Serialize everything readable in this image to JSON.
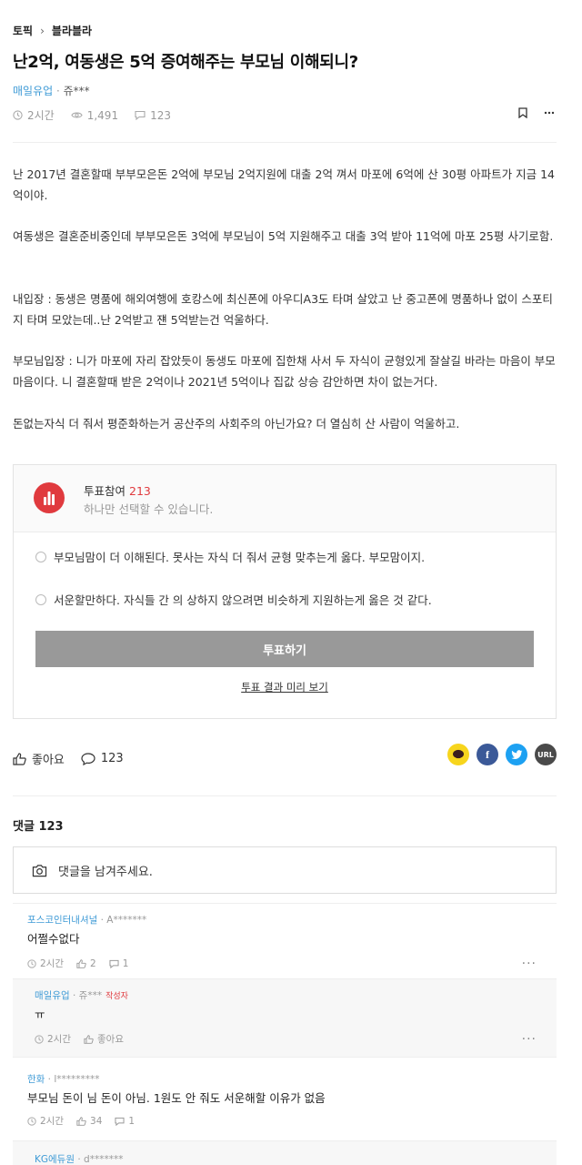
{
  "breadcrumb": {
    "topic": "토픽",
    "sep": "›",
    "board": "블라블라"
  },
  "post": {
    "title": "난2억, 여동생은 5억 증여해주는 부모님 이해되니?",
    "author_company": "매일유업",
    "author_sep": " · ",
    "author_nick": "쥬***",
    "time": "2시간",
    "views": "1,491",
    "comments": "123",
    "paragraphs": [
      "난 2017년 결혼할때 부부모은돈 2억에 부모님 2억지원에 대출 2억 껴서 마포에 6억에 산 30평 아파트가 지금 14억이야.",
      "여동생은 결혼준비중인데 부부모은돈 3억에 부모님이 5억 지원해주고 대출 3억 받아 11억에 마포 25평 사기로함.",
      "내입장 : 동생은 명품에 해외여행에 호캉스에 최신폰에 아우디A3도 타며 살았고 난 중고폰에 명품하나 없이 스포티지 타며 모았는데..난 2억받고 쟨 5억받는건 억울하다.",
      "부모님입장 : 니가 마포에 자리 잡았듯이 동생도 마포에 집한채 사서 두 자식이 균형있게 잘살길 바라는 마음이 부모마음이다. 니 결혼할때 받은 2억이나 2021년 5억이나 집값 상승 감안하면 차이 없는거다.",
      "돈없는자식 더 줘서 평준화하는거 공산주의 사회주의 아닌가요? 더 열심히 산 사람이 억울하고."
    ]
  },
  "poll": {
    "label": "투표참여",
    "count": "213",
    "sub": "하나만 선택할 수 있습니다.",
    "options": [
      "부모님맘이 더 이해된다. 못사는 자식 더 줘서 균형 맞추는게 옳다. 부모맘이지.",
      "서운할만하다. 자식들 간 의 상하지 않으려면 비슷하게 지원하는게 옳은 것 같다."
    ],
    "vote_label": "투표하기",
    "preview_label": "투표 결과 미리 보기"
  },
  "reactions": {
    "like_label": "좋아요",
    "comment_count": "123"
  },
  "share": {
    "url_label": "URL"
  },
  "comments_section": {
    "title": "댓글 123",
    "input_placeholder": "댓글을 남겨주세요."
  },
  "comments": [
    {
      "company": "포스코인터내셔널",
      "sep": " · ",
      "nick": "A*******",
      "op": "",
      "text": "어쩔수없다",
      "time": "2시간",
      "likes": "2",
      "replies": "1",
      "reply": false
    },
    {
      "company": "매일유업",
      "sep": " · ",
      "nick": "쥬***",
      "op": "작성자",
      "text": "ㅠ",
      "time": "2시간",
      "likes": "좋아요",
      "replies": "",
      "reply": true
    },
    {
      "company": "한화",
      "sep": " · ",
      "nick": "l*********",
      "op": "",
      "text": "부모님 돈이 님 돈이 아님. 1원도 안 줘도 서운해할 이유가 없음",
      "time": "2시간",
      "likes": "34",
      "replies": "1",
      "reply": false
    },
    {
      "company": "KG에듀원",
      "sep": " · ",
      "nick": "d*******",
      "op": "",
      "text": "",
      "time": "",
      "likes": "",
      "replies": "",
      "reply": true
    }
  ],
  "colors": {
    "accent_red": "#e03a3e",
    "company_blue": "#3f9bd6",
    "vote_button": "#999999",
    "kakao": "#f7d51d",
    "facebook": "#3b5998",
    "twitter": "#1da1f2",
    "url": "#4a4a4a"
  }
}
